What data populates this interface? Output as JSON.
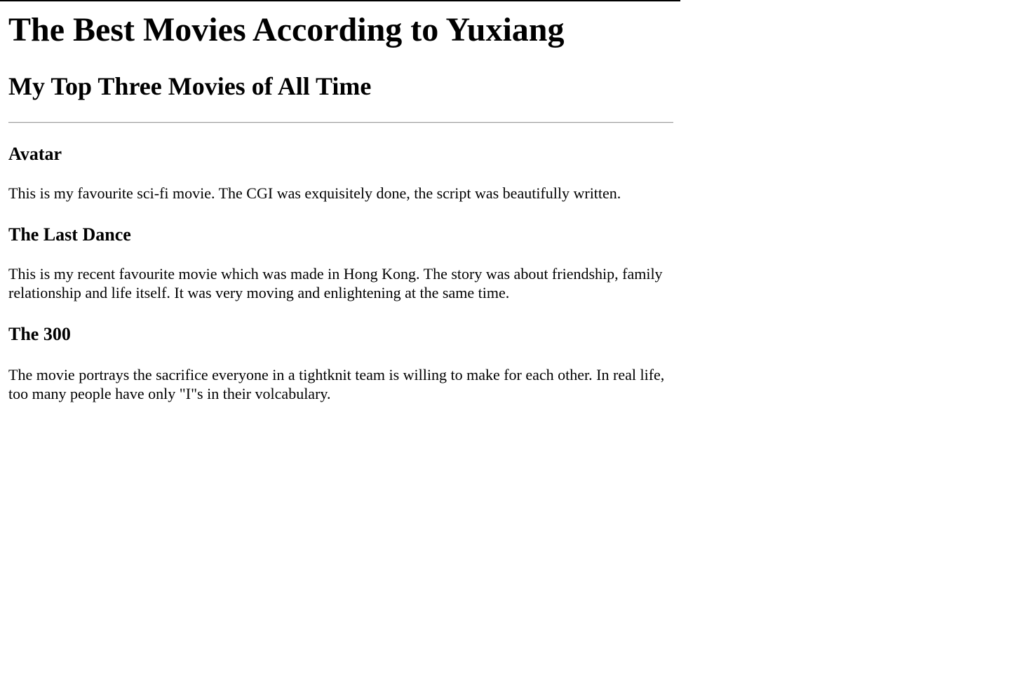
{
  "page": {
    "title": "The Best Movies According to Yuxiang",
    "subtitle": "My Top Three Movies of All Time"
  },
  "movies": [
    {
      "title": "Avatar",
      "description": "This is my favourite sci-fi movie. The CGI was exquisitely done, the script was beautifully written."
    },
    {
      "title": "The Last Dance",
      "description": "This is my recent favourite movie which was made in Hong Kong. The story was about friendship, family relationship and life itself. It was very moving and enlightening at the same time."
    },
    {
      "title": "The 300",
      "description": "The movie portrays the sacrifice everyone in a tightknit team is willing to make for each other. In real life, too many people have only \"I\"s in their volcabulary."
    }
  ]
}
